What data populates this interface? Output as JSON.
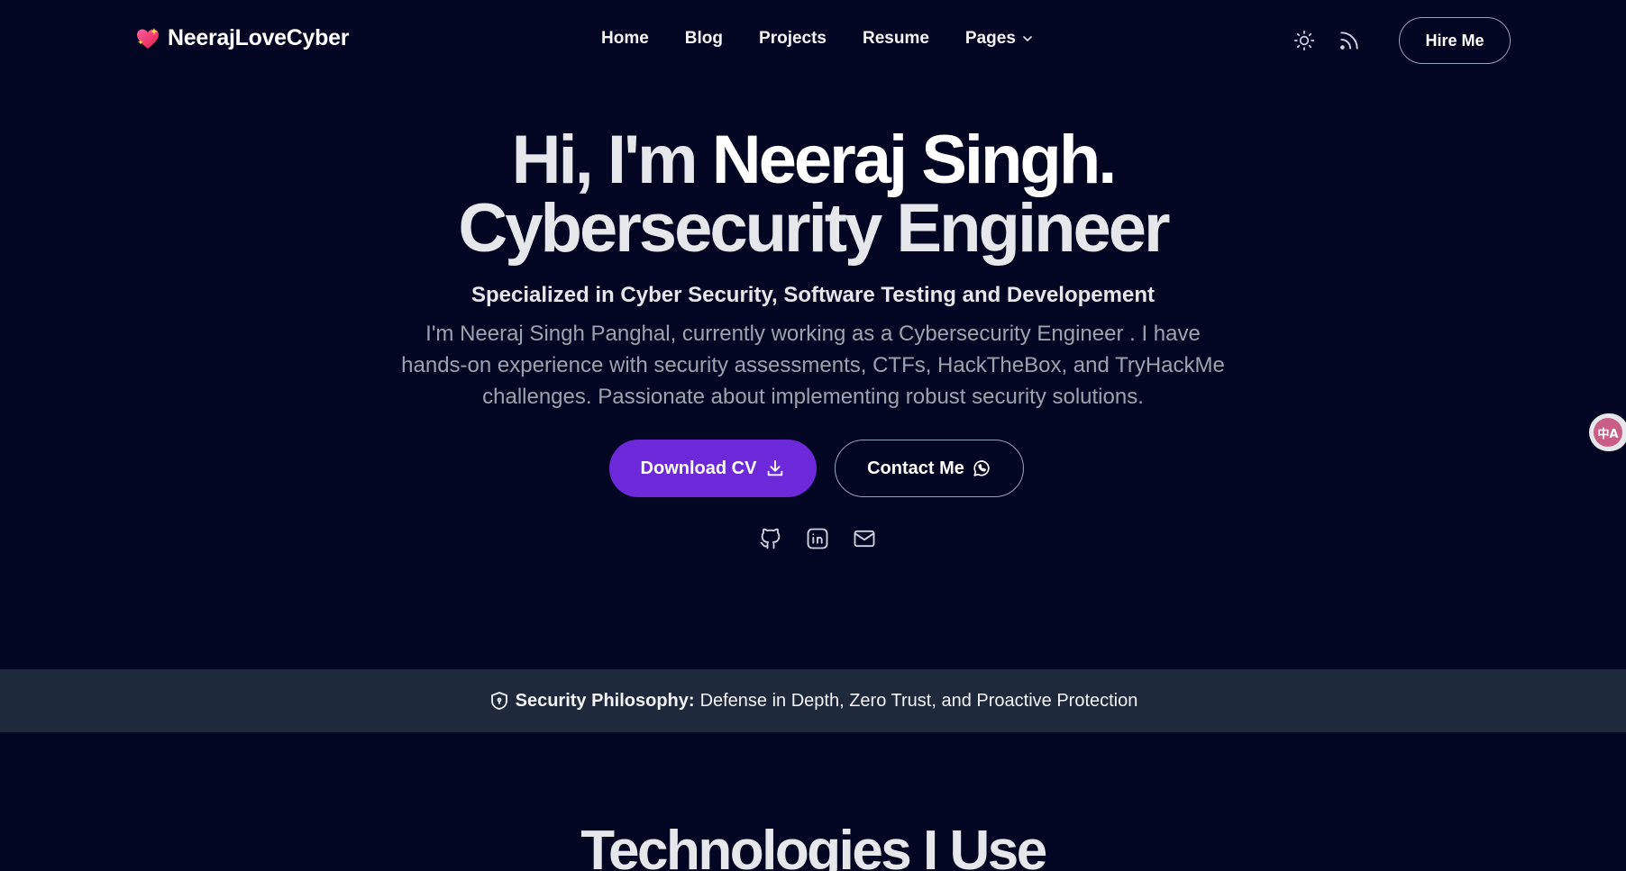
{
  "nav": {
    "brand": "NeerajLoveCyber",
    "items": [
      {
        "label": "Home"
      },
      {
        "label": "Blog"
      },
      {
        "label": "Projects"
      },
      {
        "label": "Resume"
      },
      {
        "label": "Pages"
      }
    ],
    "theme_icon": "sun-icon",
    "rss_icon": "rss-icon",
    "hire_label": "Hire Me"
  },
  "hero": {
    "title_intro": "Hi, I'm ",
    "title_name": "Neeraj Singh.",
    "title_role": "Cybersecurity Engineer",
    "subtitle": "Specialized in Cyber Security, Software Testing and Developement",
    "description": "I'm Neeraj Singh Panghal, currently working as a Cybersecurity Engineer . I have hands-on experience with security assessments, CTFs, HackTheBox, and TryHackMe challenges. Passionate about implementing robust security solutions.",
    "download_label": "Download CV",
    "contact_label": "Contact Me",
    "socials": [
      "github-icon",
      "linkedin-icon",
      "mail-icon"
    ]
  },
  "banner": {
    "label": "Security Philosophy:",
    "text": "Defense in Depth, Zero Trust, and Proactive Protection"
  },
  "section": {
    "title": "Technologies I Use"
  },
  "translate_fab": {
    "glyph": "中A"
  },
  "colors": {
    "background": "#030622",
    "accent": "#6d28d9",
    "banner": "#1e293b"
  }
}
